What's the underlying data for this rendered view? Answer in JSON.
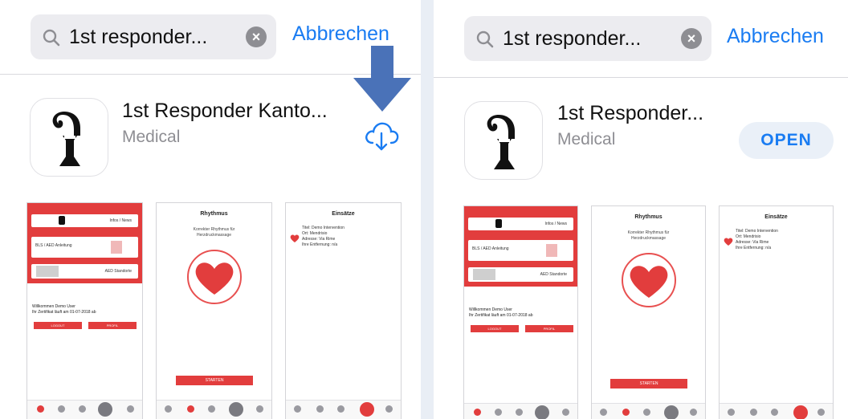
{
  "left": {
    "search": {
      "query": "1st responder...",
      "cancel_label": "Abbrechen"
    },
    "app": {
      "title": "1st Responder Kanto...",
      "category": "Medical"
    },
    "action": {
      "icon": "cloud-download-icon"
    }
  },
  "right": {
    "search": {
      "query": "1st responder...",
      "cancel_label": "Abbrechen"
    },
    "app": {
      "title": "1st Responder...",
      "category": "Medical"
    },
    "action": {
      "open_label": "OPEN"
    }
  },
  "annotation": {
    "icon": "arrow-down-icon",
    "color": "#4a72b8"
  },
  "screenshots": {
    "home": {
      "menu": [
        "Infos / News",
        "BLS / AED Anleitung",
        "AED Standorte"
      ],
      "welcome_line1": "Willkommen Demo User",
      "welcome_line2": "Ihr Zertifikat läuft am 01-07-2018 ab",
      "logout_label": "LOGOUT",
      "profile_label": "PROFIL"
    },
    "rhythm": {
      "title": "Rhythmus",
      "text_line1": "Korrekter Rhythmus für",
      "text_line2": "Herzdruckmassage",
      "start_label": "STARTEN"
    },
    "einsatz": {
      "title": "Einsätze",
      "line1": "Titel: Demo Intervention",
      "line2": "Ort: Mendrisio",
      "line3": "Adresse: Via Rime",
      "line4": "Ihre Entfernung: n/a"
    }
  },
  "colors": {
    "accent": "#1a7cf2",
    "brand_red": "#e23d3d"
  }
}
